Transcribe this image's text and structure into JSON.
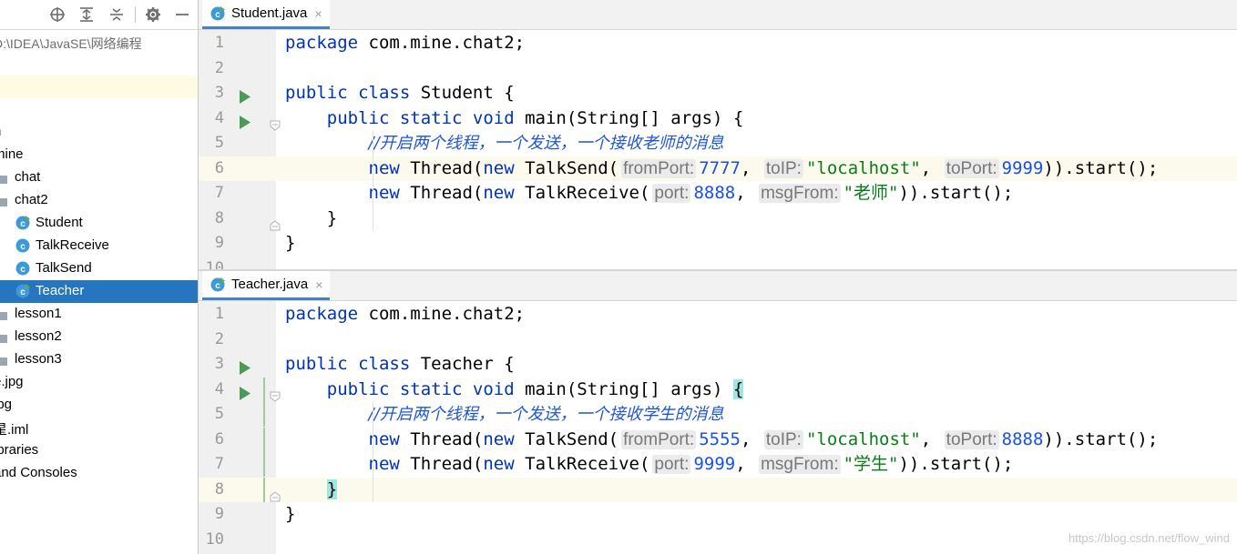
{
  "project_panel": {
    "path_text": "D:\\IDEA\\JavaSE\\网络编程",
    "tree": [
      {
        "label": "n",
        "kind": "text",
        "indent": 0
      },
      {
        "label": "mine",
        "kind": "text",
        "indent": 0
      },
      {
        "label": "chat",
        "kind": "folder",
        "indent": 1
      },
      {
        "label": "chat2",
        "kind": "folder",
        "indent": 1
      },
      {
        "label": "Student",
        "kind": "class-main",
        "indent": 2
      },
      {
        "label": "TalkReceive",
        "kind": "class",
        "indent": 2
      },
      {
        "label": "TalkSend",
        "kind": "class",
        "indent": 2
      },
      {
        "label": "Teacher",
        "kind": "class-main",
        "indent": 2,
        "selected": true
      },
      {
        "label": "lesson1",
        "kind": "folder",
        "indent": 1
      },
      {
        "label": "lesson2",
        "kind": "folder",
        "indent": 1
      },
      {
        "label": "lesson3",
        "kind": "folder",
        "indent": 1
      },
      {
        "label": "e.jpg",
        "kind": "text",
        "indent": 0
      },
      {
        "label": "jpg",
        "kind": "text",
        "indent": 0
      },
      {
        "label": "星.iml",
        "kind": "text",
        "indent": 0
      },
      {
        "label": "ibraries",
        "kind": "text",
        "indent": 0
      },
      {
        "label": "and Consoles",
        "kind": "text",
        "indent": 0
      }
    ],
    "toolbar_icons": [
      "crosshair-icon",
      "expand-all-icon",
      "collapse-all-icon",
      "gear-icon",
      "hide-icon"
    ]
  },
  "editors": [
    {
      "tab_label": "Student.java",
      "tab_close": "×",
      "lines": [
        {
          "n": "1",
          "tokens": [
            [
              "kw",
              "package"
            ],
            [
              "",
              "com.mine.chat2;"
            ]
          ]
        },
        {
          "n": "2",
          "tokens": []
        },
        {
          "n": "3",
          "tokens": [
            [
              "kw",
              "public class"
            ],
            [
              "",
              " Student {"
            ]
          ]
        },
        {
          "n": "4",
          "tokens": [
            [
              "",
              "    "
            ],
            [
              "kw",
              "public static void"
            ],
            [
              "",
              " main(String[] args) {"
            ]
          ]
        },
        {
          "n": "5",
          "tokens": [
            [
              "",
              "        "
            ],
            [
              "cm",
              "//开启两个线程，一个发送，一个接收老师的消息"
            ]
          ]
        },
        {
          "n": "6",
          "tokens": [
            [
              "",
              "        "
            ],
            [
              "kw",
              "new"
            ],
            [
              "",
              " Thread("
            ],
            [
              "kw",
              "new"
            ],
            [
              "",
              " TalkSend("
            ],
            [
              "hint",
              "fromPort:"
            ],
            [
              "num",
              "7777"
            ],
            [
              "",
              ", "
            ],
            [
              "hint",
              "toIP:"
            ],
            [
              "str",
              "\"localhost\""
            ],
            [
              "",
              ", "
            ],
            [
              "hint",
              "toPort:"
            ],
            [
              "num",
              "9999"
            ],
            [
              "",
              "))."
            ],
            [
              "",
              "start();"
            ]
          ]
        },
        {
          "n": "7",
          "tokens": [
            [
              "",
              "        "
            ],
            [
              "kw",
              "new"
            ],
            [
              "",
              " Thread("
            ],
            [
              "kw",
              "new"
            ],
            [
              "",
              " TalkReceive("
            ],
            [
              "hint",
              "port:"
            ],
            [
              "num",
              "8888"
            ],
            [
              "",
              ", "
            ],
            [
              "hint",
              "msgFrom:"
            ],
            [
              "str",
              "\"老师\""
            ],
            [
              "",
              "))."
            ],
            [
              "",
              "start();"
            ]
          ]
        },
        {
          "n": "8",
          "tokens": [
            [
              "",
              "    }"
            ]
          ]
        },
        {
          "n": "9",
          "tokens": [
            [
              "",
              "}"
            ]
          ]
        },
        {
          "n": "10",
          "tokens": []
        }
      ]
    },
    {
      "tab_label": "Teacher.java",
      "tab_close": "×",
      "lines": [
        {
          "n": "1",
          "tokens": [
            [
              "kw",
              "package"
            ],
            [
              "",
              "com.mine.chat2;"
            ]
          ]
        },
        {
          "n": "2",
          "tokens": []
        },
        {
          "n": "3",
          "tokens": [
            [
              "kw",
              "public class"
            ],
            [
              "",
              " Teacher {"
            ]
          ]
        },
        {
          "n": "4",
          "tokens": [
            [
              "",
              "    "
            ],
            [
              "kw",
              "public static void"
            ],
            [
              "",
              " main(String[] args) "
            ],
            [
              "brace",
              "{"
            ]
          ]
        },
        {
          "n": "5",
          "tokens": [
            [
              "",
              "        "
            ],
            [
              "cm",
              "//开启两个线程，一个发送，一个接收学生的消息"
            ]
          ]
        },
        {
          "n": "6",
          "tokens": [
            [
              "",
              "        "
            ],
            [
              "kw",
              "new"
            ],
            [
              "",
              " Thread("
            ],
            [
              "kw",
              "new"
            ],
            [
              "",
              " TalkSend("
            ],
            [
              "hint",
              "fromPort:"
            ],
            [
              "num",
              "5555"
            ],
            [
              "",
              ", "
            ],
            [
              "hint",
              "toIP:"
            ],
            [
              "str",
              "\"localhost\""
            ],
            [
              "",
              ", "
            ],
            [
              "hint",
              "toPort:"
            ],
            [
              "num",
              "8888"
            ],
            [
              "",
              "))."
            ],
            [
              "",
              "start();"
            ]
          ]
        },
        {
          "n": "7",
          "tokens": [
            [
              "",
              "        "
            ],
            [
              "kw",
              "new"
            ],
            [
              "",
              " Thread("
            ],
            [
              "kw",
              "new"
            ],
            [
              "",
              " TalkReceive("
            ],
            [
              "hint",
              "port:"
            ],
            [
              "num",
              "9999"
            ],
            [
              "",
              ", "
            ],
            [
              "hint",
              "msgFrom:"
            ],
            [
              "str",
              "\"学生\""
            ],
            [
              "",
              "))."
            ],
            [
              "",
              "start();"
            ]
          ]
        },
        {
          "n": "8",
          "tokens": [
            [
              "",
              "    "
            ],
            [
              "brace",
              "}"
            ]
          ]
        },
        {
          "n": "9",
          "tokens": [
            [
              "",
              "}"
            ]
          ]
        },
        {
          "n": "10",
          "tokens": []
        }
      ]
    }
  ],
  "watermark": "https://blog.csdn.net/flow_wind",
  "colors": {
    "keyword": "#0033b3",
    "comment": "#1f56d4",
    "number": "#1750eb",
    "string": "#067d17",
    "selection": "#2675bf",
    "run_icon": "#499c54"
  }
}
